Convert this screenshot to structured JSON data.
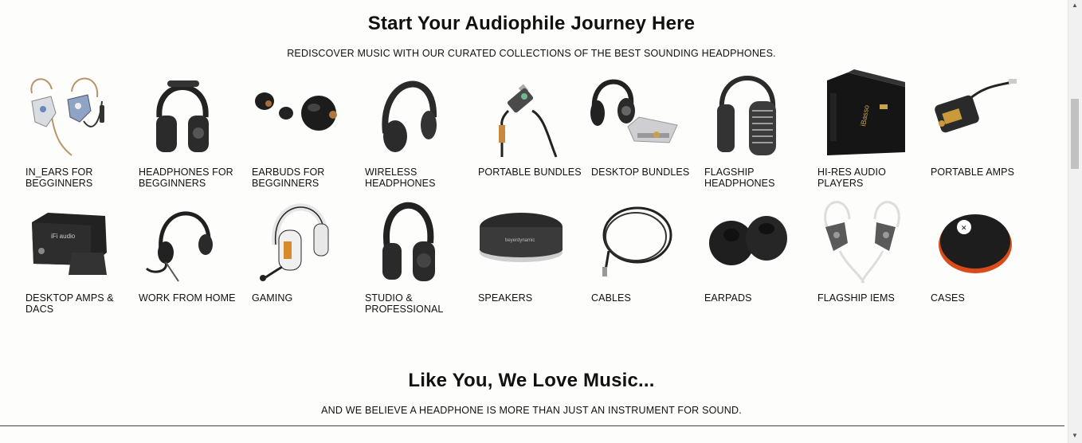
{
  "section1": {
    "title": "Start Your Audiophile Journey Here",
    "subtitle": "REDISCOVER MUSIC WITH OUR CURATED COLLECTIONS OF THE BEST SOUNDING HEADPHONES."
  },
  "categories": [
    {
      "label": "IN_EARS FOR BEGGINNERS",
      "icon": "iem-icon"
    },
    {
      "label": "HEADPHONES FOR BEGGINNERS",
      "icon": "headphones-icon"
    },
    {
      "label": "EARBUDS FOR BEGGINNERS",
      "icon": "earbuds-icon"
    },
    {
      "label": "WIRELESS HEADPHONES",
      "icon": "wireless-headphones-icon"
    },
    {
      "label": "PORTABLE BUNDLES",
      "icon": "dongle-dac-icon"
    },
    {
      "label": "DESKTOP BUNDLES",
      "icon": "desktop-bundle-icon"
    },
    {
      "label": "FLAGSHIP HEADPHONES",
      "icon": "planar-headphones-icon"
    },
    {
      "label": "HI-RES AUDIO PLAYERS",
      "icon": "audio-player-icon"
    },
    {
      "label": "PORTABLE AMPS",
      "icon": "portable-amp-icon"
    },
    {
      "label": "DESKTOP AMPS & DACS",
      "icon": "desktop-dac-icon"
    },
    {
      "label": "WORK FROM HOME",
      "icon": "headset-icon"
    },
    {
      "label": "GAMING",
      "icon": "gaming-headset-icon"
    },
    {
      "label": "STUDIO & PROFESSIONAL",
      "icon": "studio-headphones-icon"
    },
    {
      "label": "SPEAKERS",
      "icon": "speakerphone-icon"
    },
    {
      "label": "CABLES",
      "icon": "cable-icon"
    },
    {
      "label": "EARPADS",
      "icon": "foam-tips-icon"
    },
    {
      "label": "FLAGSHIP IEMS",
      "icon": "flagship-iem-icon"
    },
    {
      "label": "CASES",
      "icon": "case-icon"
    }
  ],
  "section2": {
    "title": "Like You, We Love Music...",
    "subtitle": "AND WE BELIEVE A HEADPHONE IS MORE THAN JUST AN INSTRUMENT FOR SOUND."
  }
}
